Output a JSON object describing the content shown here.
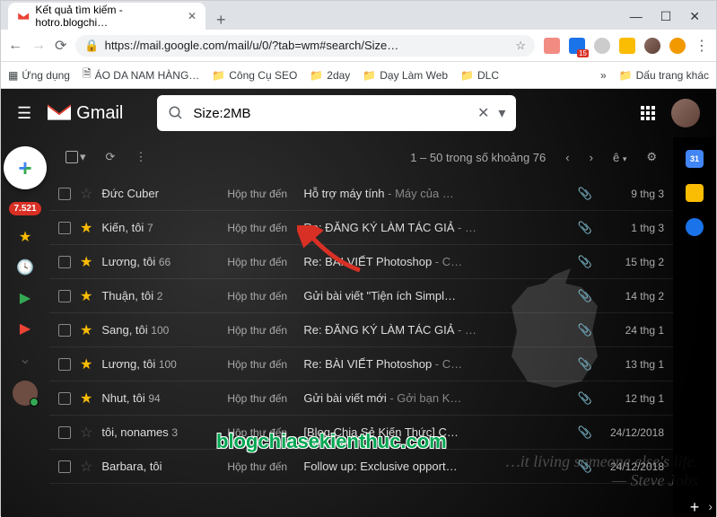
{
  "browser": {
    "tab_title": "Kết quả tìm kiếm - hotro.blogchi…",
    "url": "https://mail.google.com/mail/u/0/?tab=wm#search/Size…",
    "bookmarks": [
      "Ứng dụng",
      "ÁO DA NAM HÀNG…",
      "Công Cụ SEO",
      "2day",
      "Dạy Làm Web",
      "DLC",
      "Dấu trang khác"
    ]
  },
  "gmail": {
    "brand": "Gmail",
    "search": "Size:2MB ",
    "pager": "1 – 50 trong số khoảng 76",
    "input_char": "ê",
    "unread_badge": "7.521",
    "inbox_label": "Hộp thư đến",
    "calendar_day": "31",
    "rows": [
      {
        "starred": false,
        "sender": "Đức Cuber",
        "count": "",
        "subject": "Hỗ trợ máy tính",
        "snippet": " - Máy của …",
        "date": "9 thg 3"
      },
      {
        "starred": true,
        "sender": "Kiến, tôi",
        "count": "7",
        "subject": "Re: ĐĂNG KÝ LÀM TÁC GIẢ",
        "snippet": " - …",
        "date": "1 thg 3"
      },
      {
        "starred": true,
        "sender": "Lương, tôi",
        "count": "66",
        "subject": "Re: BÀI VIẾT Photoshop",
        "snippet": " - C…",
        "date": "15 thg 2"
      },
      {
        "starred": true,
        "sender": "Thuận, tôi",
        "count": "2",
        "subject": "Gửi bài viết \"Tiện ích Simpl…",
        "snippet": "",
        "date": "14 thg 2"
      },
      {
        "starred": true,
        "sender": "Sang, tôi",
        "count": "100",
        "subject": "Re: ĐĂNG KÝ LÀM TÁC GIẢ",
        "snippet": " - …",
        "date": "24 thg 1"
      },
      {
        "starred": true,
        "sender": "Lương, tôi",
        "count": "100",
        "subject": "Re: BÀI VIẾT Photoshop",
        "snippet": " - C…",
        "date": "13 thg 1"
      },
      {
        "starred": true,
        "sender": "Nhut, tôi",
        "count": "94",
        "subject": "Gửi bài viết mới",
        "snippet": " - Gởi bạn K…",
        "date": "12 thg 1"
      },
      {
        "starred": false,
        "sender": "tôi, nonames",
        "count": "3",
        "subject": "[Blog Chia Sẻ Kiến Thức] C…",
        "snippet": "",
        "date": "24/12/2018"
      },
      {
        "starred": false,
        "sender": "Barbara, tôi",
        "count": "",
        "subject": "Follow up: Exclusive opport…",
        "snippet": "",
        "date": "24/12/2018"
      }
    ]
  },
  "annotation": {
    "watermark": "blogchiasekienthuc.com"
  }
}
